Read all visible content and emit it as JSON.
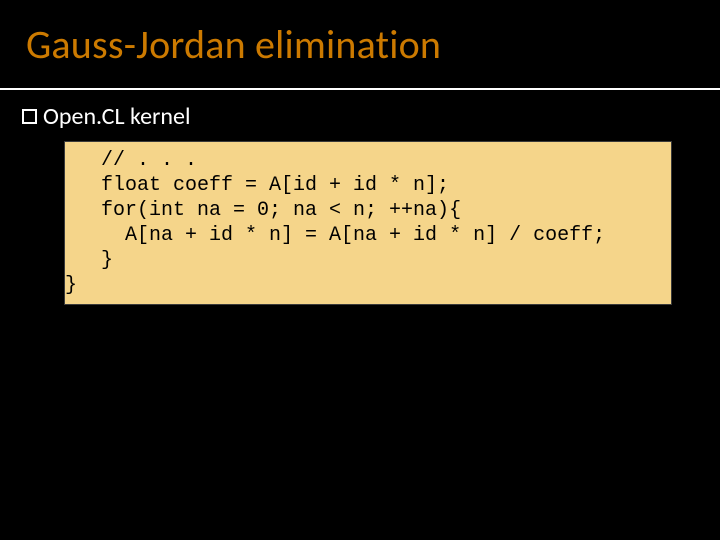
{
  "title": "Gauss-Jordan elimination",
  "bullet": "Open.CL kernel",
  "code": "   // . . .\n   float coeff = A[id + id * n];\n   for(int na = 0; na < n; ++na){\n     A[na + id * n] = A[na + id * n] / coeff;\n   }\n}"
}
